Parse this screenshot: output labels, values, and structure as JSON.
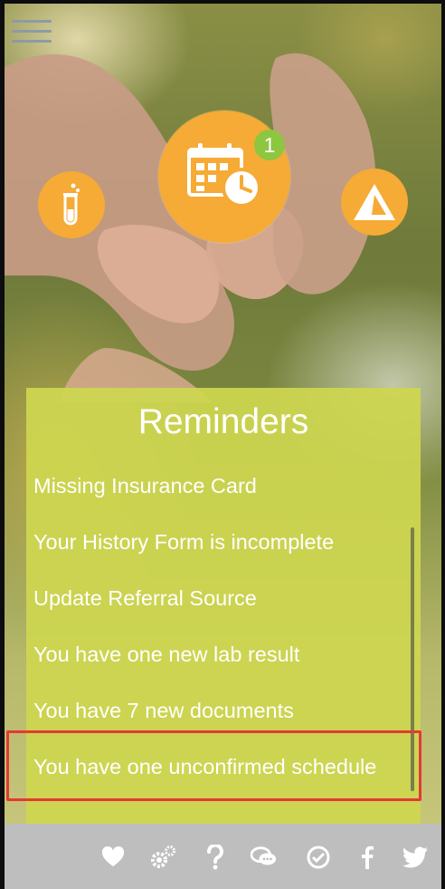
{
  "top_nav": {
    "menu_icon": "hamburger-menu-icon"
  },
  "shortcuts": [
    {
      "name": "lab-results",
      "icon": "test-tube-icon"
    },
    {
      "name": "schedule",
      "icon": "calendar-clock-icon",
      "badge": "1"
    },
    {
      "name": "brand",
      "icon": "triangle-logo-icon"
    }
  ],
  "reminders": {
    "title": "Reminders",
    "items": [
      "Missing Insurance Card",
      "Your History Form is incomplete",
      "Update Referral Source",
      "You have one new lab result",
      "You have 7 new documents",
      "You have one unconfirmed schedule"
    ]
  },
  "footer": {
    "icons": [
      "heart-icon",
      "gears-icon",
      "question-icon",
      "chat-icon",
      "check-circle-icon",
      "facebook-icon",
      "twitter-icon"
    ]
  },
  "colors": {
    "accent_orange": "#f5ab35",
    "panel_green": "#cdd650",
    "badge_green": "#8dc63f",
    "highlight_red": "#e53935",
    "footer_gray": "#bebebe"
  }
}
